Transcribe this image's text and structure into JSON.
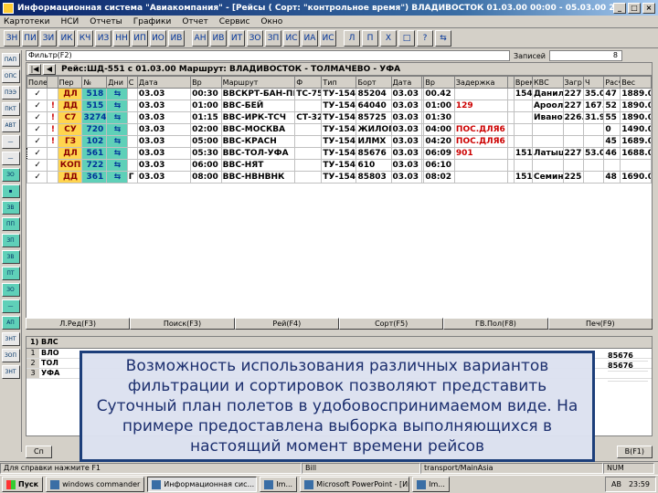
{
  "window": {
    "title": "Информационная система \"Авиакомпания\" - [Рейсы ( Сорт: \"контрольное время\") ВЛАДИВОСТОК 01.03.00 00:00 - 05.03.00 23:59]"
  },
  "menu": [
    "Картотеки",
    "НСИ",
    "Отчеты",
    "Графики",
    "Отчет",
    "Сервис",
    "Окно"
  ],
  "toolbar": {
    "buttons": [
      "ЗН",
      "ПИ",
      "ЗИ",
      "ИК",
      "КЧ",
      "ИЗ",
      "НН",
      "ИП",
      "ИО",
      "ИВ",
      "АН",
      "ИВ",
      "ИТ",
      "ЗО",
      "ЗП",
      "ИС",
      "ИА",
      "ИС",
      "Л",
      "П",
      "Х",
      "□",
      "?",
      "⇆"
    ]
  },
  "left_bar": [
    "ПАП",
    "ОПС",
    "ПЭЭ",
    "ПКТ",
    "АВТ",
    "—",
    "—",
    "ЗО",
    "▪",
    "ЗВ",
    "ПП",
    "ЗП",
    "ЗВ",
    "ПТ",
    "ЗО",
    "—",
    "АП",
    "ЗНТ",
    "ЗОП",
    "ЗНТ"
  ],
  "filter": {
    "label": "Фильтр(F2)",
    "count_label": "Записей",
    "count": "8"
  },
  "route_bar": {
    "text": "Рейс:ШД-551 с 01.03.00 Маршрут: ВЛАДИВОСТОК - ТОЛМАЧЕВО - УФА"
  },
  "table": {
    "headers": [
      "Полет",
      "Пер",
      "№",
      "Дни",
      "С",
      "Дата",
      "Вр",
      "Маршрут",
      "Ф",
      "Тип",
      "Борт",
      "Дата",
      "Вр",
      "Задержка",
      "Примеч",
      "Время",
      "КВС",
      "Загр",
      "Ч",
      "Расч",
      "Факт",
      "Вес"
    ],
    "rows": [
      [
        "✓",
        "",
        "ДЛ",
        "518",
        "⇆",
        "",
        "03.03",
        "00:30",
        "ВВСКРТ-БАН-ПБ",
        "ТС-75",
        "ТУ-154",
        "85204",
        "03.03",
        "",
        "00.42",
        "",
        "",
        "154",
        "Данил",
        "227",
        "35.0",
        "47",
        "1889.0"
      ],
      [
        "✓",
        "!",
        "ДД",
        "515",
        "⇆",
        "",
        "03.03",
        "01:00",
        "ВВС-БЕЙ",
        "",
        "ТУ-154",
        "64040",
        "03.03",
        "",
        "01:00",
        "129",
        "",
        "",
        "Ароол",
        "227",
        "167.5",
        "52",
        "1890.0"
      ],
      [
        "✓",
        "!",
        "С7",
        "3274",
        "⇆",
        "",
        "03.03",
        "01:15",
        "ВВС-ИРК-ТСЧ",
        "СТ-3274",
        "ТУ-154",
        "85725",
        "03.03",
        "",
        "01:30",
        "",
        "",
        "",
        "Иванов",
        "226.0",
        "31.9",
        "55",
        "1890.0"
      ],
      [
        "✓",
        "!",
        "СУ",
        "720",
        "⇆",
        "",
        "03.03",
        "02:00",
        "ВВС-МОСКВА",
        "",
        "ТУ-154",
        "ЖИЛОП",
        "03.03",
        "",
        "04:00",
        "ПОС.ДЛЯ6",
        "",
        "",
        "",
        "",
        "",
        "0",
        "1490.0"
      ],
      [
        "✓",
        "!",
        "ГЗ",
        "102",
        "⇆",
        "",
        "03.03",
        "05:00",
        "ВВС-КРАСН",
        "",
        "ТУ-154",
        "ИЛМХ",
        "03.03",
        "",
        "04:20",
        "ПОС.ДЛЯ6",
        "",
        "",
        "",
        "",
        "",
        "45",
        "1689.0"
      ],
      [
        "✓",
        "",
        "ДЛ",
        "561",
        "⇆",
        "",
        "03.03",
        "05:30",
        "ВВС-ТОЛ-УФА",
        "",
        "ТУ-154",
        "85676",
        "03.03",
        "",
        "06:09",
        "901",
        "",
        "151",
        "Латышев",
        "227",
        "53.0",
        "46",
        "1688.0"
      ],
      [
        "✓",
        "",
        "КОП",
        "722",
        "⇆",
        "",
        "03.03",
        "06:00",
        "ВВС-НЯТ",
        "",
        "ТУ-154",
        "610",
        "03.03",
        "",
        "06:10",
        "",
        "",
        "",
        "",
        "",
        "",
        "",
        ""
      ],
      [
        "✓",
        "",
        "ДД",
        "361",
        "⇆",
        "Г",
        "03.03",
        "08:00",
        "ВВС-НВНВНК",
        "",
        "ТУ-154",
        "85803",
        "03.03",
        "",
        "08:02",
        "",
        "",
        "151",
        "Семин В",
        "225",
        "",
        "48",
        "1690.0"
      ]
    ]
  },
  "tabs": [
    "Л.Ред(F3)",
    "Поиск(F3)",
    "Рей(F4)",
    "Сорт(F5)",
    "ГВ.Пол(F8)",
    "Печ(F9)"
  ],
  "lower": {
    "nav": "1) ВЛС",
    "rows": [
      {
        "n": "1",
        "code": "ВЛО"
      },
      {
        "n": "2",
        "code": "ТОЛ"
      },
      {
        "n": "3",
        "code": "УФА"
      }
    ],
    "right": [
      "85676",
      "85676",
      ""
    ]
  },
  "bottom_buttons": [
    "Сп",
    "В(F1)"
  ],
  "statusbar": {
    "hint": "Для справки нажмите F1",
    "cell2": "Bill",
    "cell3": "transport/MainAsia",
    "cell4": "NUM"
  },
  "taskbar": {
    "start": "Пуск",
    "tasks": [
      "windows commander",
      "Информационная сис...",
      "Im...",
      "Microsoft PowerPoint - [Ин...",
      "Im..."
    ],
    "tray": [
      "AB",
      "23:59"
    ]
  },
  "overlay": {
    "text": "Возможность использования различных вариантов фильтрации и сортировок позволяют представить Суточный план полетов в удобовоспринимаемом виде. На примере предоставлена выборка выполняющихся в настоящий момент времени рейсов"
  }
}
